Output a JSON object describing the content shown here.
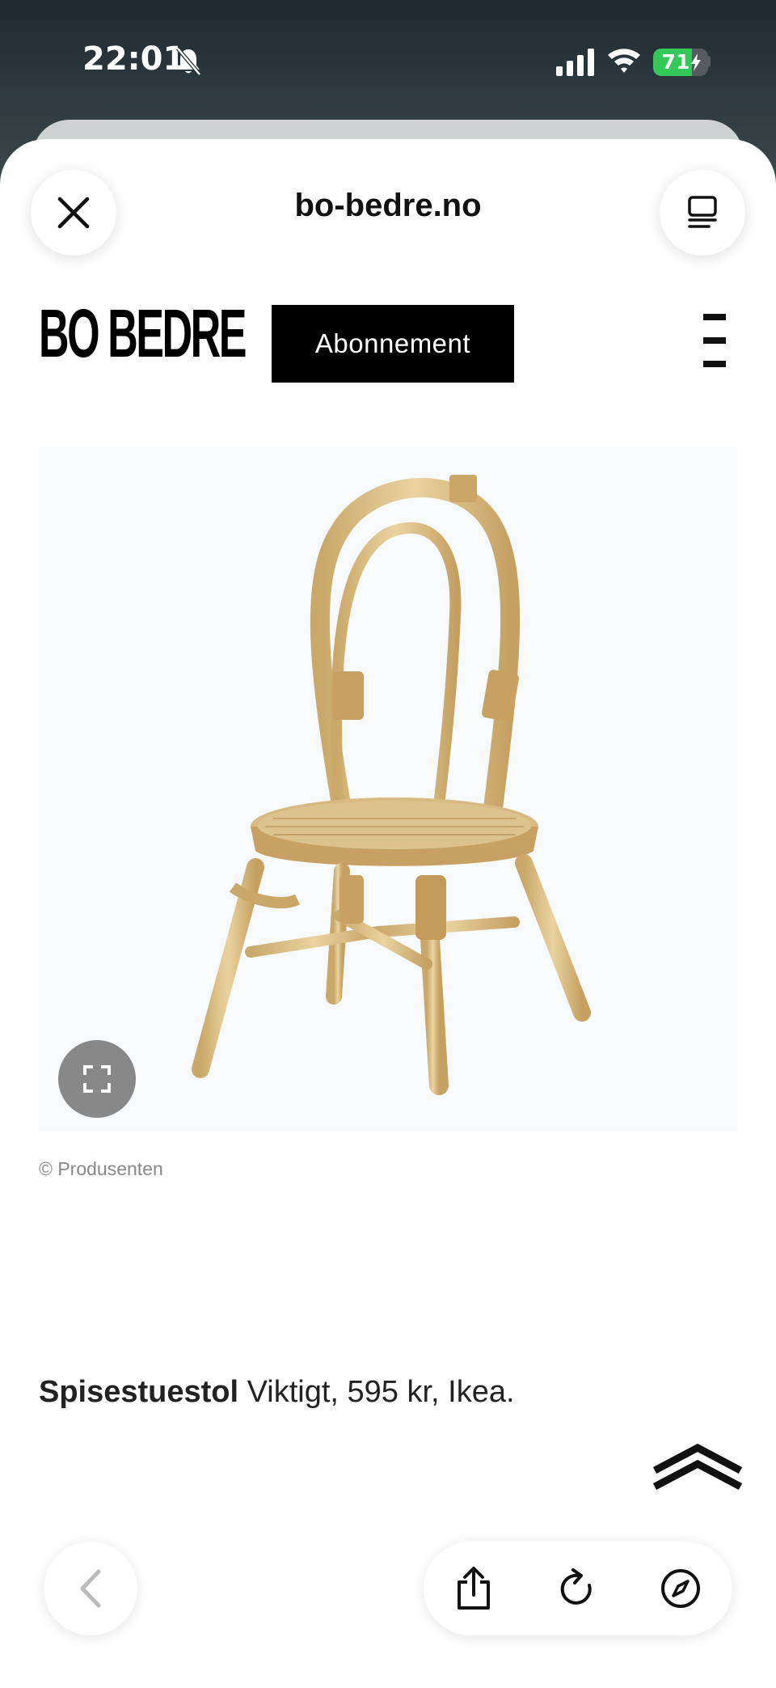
{
  "status_bar": {
    "time": "22:01",
    "battery_level": 71,
    "battery_text": "71",
    "icons": [
      "bell-slash-icon",
      "cellular-signal-icon",
      "wifi-icon",
      "battery-charging-icon"
    ]
  },
  "browser": {
    "url": "bo-bedre.no",
    "close_icon": "close-icon",
    "reader_icon": "reader-mode-icon"
  },
  "site": {
    "logo": "BO BEDRE",
    "subscribe_label": "Abonnement",
    "menu_icon": "hamburger-menu-icon"
  },
  "article": {
    "image_alt": "rattan chair",
    "image_credit": "© Produsenten",
    "expand_icon": "expand-icon",
    "caption_bold": "Spisestuestol",
    "caption_rest": " Viktigt, 595 kr, Ikea.",
    "scroll_top_icon": "scroll-to-top-icon"
  },
  "toolbar": {
    "icons": [
      "back-chevron-icon",
      "share-icon",
      "reload-icon",
      "compass-icon"
    ]
  },
  "colors": {
    "battery_green": "#34c759",
    "header_black": "#000000",
    "expand_gray": "#888888"
  }
}
